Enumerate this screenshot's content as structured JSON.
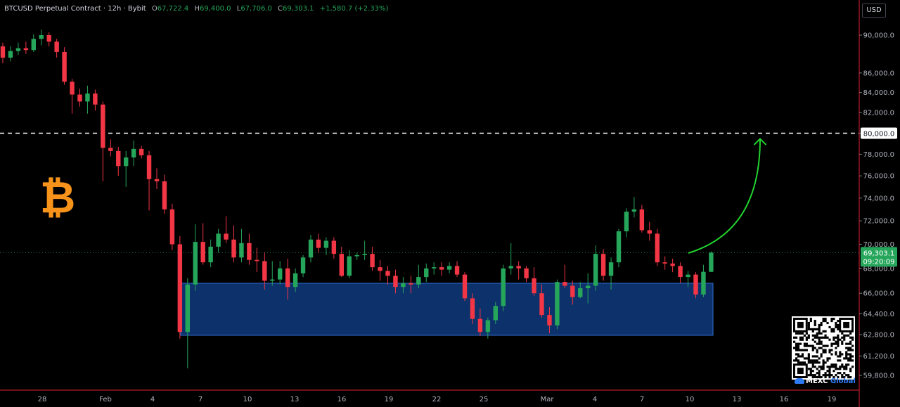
{
  "header": {
    "symbol": "BTCUSD Perpetual Contract",
    "interval": "12h",
    "exchange": "Bybit",
    "o_label": "O",
    "o_value": "67,722.4",
    "h_label": "H",
    "h_value": "69,400.0",
    "l_label": "L",
    "l_value": "67,706.0",
    "c_label": "C",
    "c_value": "69,303.1",
    "change": "+1,580.7 (+2.33%)"
  },
  "currency_button": "USD",
  "price_label": {
    "price": "69,303.1",
    "countdown": "09:20:09"
  },
  "level_label": "80,000.0",
  "branding": {
    "exchange_name": "MEXC",
    "exchange_suffix": "Global",
    "logo_icon": "bitcoin-icon",
    "qr_icon": "qr-code-icon"
  },
  "colors": {
    "up": "#26a65b",
    "down": "#f23645",
    "zone": "#0f3a7d",
    "zone_border": "#2f6fd6",
    "arrow": "#22d32e",
    "bitcoin": "#f7931a"
  },
  "chart_data": {
    "type": "candlestick",
    "interval": "12h",
    "y_scale": "log",
    "ylim": [
      59000,
      93000
    ],
    "y_ticks": [
      "90,000.0",
      "86,000.0",
      "84,000.0",
      "82,000.0",
      "80,000.0",
      "78,000.0",
      "76,000.0",
      "74,000.0",
      "72,000.0",
      "70,000.0",
      "68,000.0",
      "66,000.0",
      "64,400.0",
      "62,800.0",
      "61,200.0",
      "59,800.0"
    ],
    "x_ticks": [
      "28",
      "Feb",
      "4",
      "7",
      "10",
      "13",
      "16",
      "19",
      "22",
      "25",
      "Mar",
      "4",
      "7",
      "10",
      "13",
      "16",
      "19"
    ],
    "candles": [
      {
        "o": 88800,
        "h": 89200,
        "l": 87000,
        "c": 87600
      },
      {
        "o": 87600,
        "h": 88800,
        "l": 87200,
        "c": 88300
      },
      {
        "o": 88300,
        "h": 89200,
        "l": 87900,
        "c": 88600
      },
      {
        "o": 88600,
        "h": 89300,
        "l": 88000,
        "c": 88400
      },
      {
        "o": 88400,
        "h": 90100,
        "l": 88200,
        "c": 89600
      },
      {
        "o": 89600,
        "h": 90600,
        "l": 88900,
        "c": 90000
      },
      {
        "o": 90000,
        "h": 90300,
        "l": 88800,
        "c": 89300
      },
      {
        "o": 89300,
        "h": 89600,
        "l": 87600,
        "c": 88200
      },
      {
        "o": 88200,
        "h": 88700,
        "l": 84800,
        "c": 85100
      },
      {
        "o": 85100,
        "h": 85400,
        "l": 81900,
        "c": 83800
      },
      {
        "o": 83800,
        "h": 84400,
        "l": 82600,
        "c": 83100
      },
      {
        "o": 83100,
        "h": 84700,
        "l": 81900,
        "c": 83900
      },
      {
        "o": 83900,
        "h": 84300,
        "l": 82200,
        "c": 82800
      },
      {
        "o": 82800,
        "h": 83100,
        "l": 75500,
        "c": 78600
      },
      {
        "o": 78600,
        "h": 79400,
        "l": 77800,
        "c": 78300
      },
      {
        "o": 78300,
        "h": 78700,
        "l": 76000,
        "c": 76900
      },
      {
        "o": 76900,
        "h": 78300,
        "l": 75000,
        "c": 77700
      },
      {
        "o": 77700,
        "h": 79300,
        "l": 76900,
        "c": 78500
      },
      {
        "o": 78500,
        "h": 78800,
        "l": 77600,
        "c": 77900
      },
      {
        "o": 77900,
        "h": 78300,
        "l": 72900,
        "c": 75700
      },
      {
        "o": 75700,
        "h": 76700,
        "l": 74800,
        "c": 75500
      },
      {
        "o": 75500,
        "h": 76100,
        "l": 72600,
        "c": 73000
      },
      {
        "o": 73000,
        "h": 73500,
        "l": 69500,
        "c": 70000
      },
      {
        "o": 70000,
        "h": 70700,
        "l": 62500,
        "c": 63000
      },
      {
        "o": 63000,
        "h": 67200,
        "l": 60300,
        "c": 66700
      },
      {
        "o": 66700,
        "h": 71700,
        "l": 66200,
        "c": 70200
      },
      {
        "o": 70200,
        "h": 71800,
        "l": 68300,
        "c": 68500
      },
      {
        "o": 68500,
        "h": 70400,
        "l": 68100,
        "c": 69800
      },
      {
        "o": 69800,
        "h": 71300,
        "l": 69300,
        "c": 70900
      },
      {
        "o": 70900,
        "h": 72400,
        "l": 70100,
        "c": 70400
      },
      {
        "o": 70400,
        "h": 71600,
        "l": 68500,
        "c": 68900
      },
      {
        "o": 68900,
        "h": 71300,
        "l": 68500,
        "c": 70100
      },
      {
        "o": 70100,
        "h": 70900,
        "l": 68300,
        "c": 68700
      },
      {
        "o": 68700,
        "h": 69700,
        "l": 67700,
        "c": 68600
      },
      {
        "o": 68600,
        "h": 69300,
        "l": 66300,
        "c": 67000
      },
      {
        "o": 67000,
        "h": 68600,
        "l": 66600,
        "c": 67100
      },
      {
        "o": 67100,
        "h": 68600,
        "l": 66700,
        "c": 68000
      },
      {
        "o": 68000,
        "h": 68800,
        "l": 65500,
        "c": 66500
      },
      {
        "o": 66500,
        "h": 68000,
        "l": 66100,
        "c": 67600
      },
      {
        "o": 67600,
        "h": 69100,
        "l": 67300,
        "c": 68900
      },
      {
        "o": 68900,
        "h": 70800,
        "l": 68500,
        "c": 70400
      },
      {
        "o": 70400,
        "h": 70900,
        "l": 69300,
        "c": 69700
      },
      {
        "o": 69700,
        "h": 70600,
        "l": 69100,
        "c": 70300
      },
      {
        "o": 70300,
        "h": 70600,
        "l": 68800,
        "c": 69200
      },
      {
        "o": 69200,
        "h": 69800,
        "l": 67300,
        "c": 67400
      },
      {
        "o": 67400,
        "h": 69500,
        "l": 67200,
        "c": 69000
      },
      {
        "o": 69000,
        "h": 69300,
        "l": 68700,
        "c": 69100
      },
      {
        "o": 69100,
        "h": 70300,
        "l": 68700,
        "c": 69200
      },
      {
        "o": 69200,
        "h": 69800,
        "l": 67800,
        "c": 68100
      },
      {
        "o": 68100,
        "h": 68700,
        "l": 67000,
        "c": 67800
      },
      {
        "o": 67800,
        "h": 68200,
        "l": 66700,
        "c": 67400
      },
      {
        "o": 67400,
        "h": 67900,
        "l": 66000,
        "c": 66500
      },
      {
        "o": 66500,
        "h": 67300,
        "l": 66000,
        "c": 66800
      },
      {
        "o": 66800,
        "h": 67400,
        "l": 66000,
        "c": 66700
      },
      {
        "o": 66700,
        "h": 68300,
        "l": 66400,
        "c": 67300
      },
      {
        "o": 67300,
        "h": 68400,
        "l": 66900,
        "c": 68000
      },
      {
        "o": 68000,
        "h": 68500,
        "l": 67500,
        "c": 68100
      },
      {
        "o": 68100,
        "h": 68500,
        "l": 67400,
        "c": 67900
      },
      {
        "o": 67900,
        "h": 68500,
        "l": 67600,
        "c": 68200
      },
      {
        "o": 68200,
        "h": 68600,
        "l": 67300,
        "c": 67500
      },
      {
        "o": 67500,
        "h": 67700,
        "l": 65400,
        "c": 65600
      },
      {
        "o": 65600,
        "h": 66000,
        "l": 63600,
        "c": 64000
      },
      {
        "o": 64000,
        "h": 64800,
        "l": 62700,
        "c": 63000
      },
      {
        "o": 63000,
        "h": 64100,
        "l": 62500,
        "c": 63900
      },
      {
        "o": 63900,
        "h": 65300,
        "l": 63600,
        "c": 65000
      },
      {
        "o": 65000,
        "h": 68300,
        "l": 64600,
        "c": 68000
      },
      {
        "o": 68000,
        "h": 70100,
        "l": 67500,
        "c": 68200
      },
      {
        "o": 68200,
        "h": 68600,
        "l": 67100,
        "c": 68000
      },
      {
        "o": 68000,
        "h": 68200,
        "l": 66900,
        "c": 67200
      },
      {
        "o": 67200,
        "h": 68100,
        "l": 65800,
        "c": 66000
      },
      {
        "o": 66000,
        "h": 66700,
        "l": 64100,
        "c": 64300
      },
      {
        "o": 64300,
        "h": 64900,
        "l": 62900,
        "c": 63500
      },
      {
        "o": 63500,
        "h": 67100,
        "l": 63200,
        "c": 66900
      },
      {
        "o": 66900,
        "h": 68300,
        "l": 66400,
        "c": 66600
      },
      {
        "o": 66600,
        "h": 67000,
        "l": 65100,
        "c": 65700
      },
      {
        "o": 65700,
        "h": 66900,
        "l": 65600,
        "c": 66400
      },
      {
        "o": 66400,
        "h": 67600,
        "l": 65200,
        "c": 66600
      },
      {
        "o": 66600,
        "h": 69900,
        "l": 66200,
        "c": 69200
      },
      {
        "o": 69200,
        "h": 69600,
        "l": 67000,
        "c": 67400
      },
      {
        "o": 67400,
        "h": 68900,
        "l": 66300,
        "c": 68500
      },
      {
        "o": 68500,
        "h": 71300,
        "l": 68100,
        "c": 71100
      },
      {
        "o": 71100,
        "h": 73100,
        "l": 70600,
        "c": 72800
      },
      {
        "o": 72800,
        "h": 74100,
        "l": 72300,
        "c": 73000
      },
      {
        "o": 73000,
        "h": 73400,
        "l": 71000,
        "c": 71200
      },
      {
        "o": 71200,
        "h": 71900,
        "l": 70300,
        "c": 70900
      },
      {
        "o": 70900,
        "h": 71300,
        "l": 68200,
        "c": 68500
      },
      {
        "o": 68500,
        "h": 69000,
        "l": 67900,
        "c": 68400
      },
      {
        "o": 68400,
        "h": 68800,
        "l": 67700,
        "c": 68200
      },
      {
        "o": 68200,
        "h": 68500,
        "l": 66800,
        "c": 67300
      },
      {
        "o": 67300,
        "h": 67800,
        "l": 66500,
        "c": 67500
      },
      {
        "o": 67500,
        "h": 67700,
        "l": 65600,
        "c": 65900
      },
      {
        "o": 65900,
        "h": 68300,
        "l": 65700,
        "c": 67722.4
      },
      {
        "o": 67722.4,
        "h": 69400,
        "l": 67706,
        "c": 69303.1
      }
    ],
    "zone": {
      "from_candle": 24,
      "to_candle": 100,
      "low": 62750,
      "high": 66800
    },
    "horizontal_line": 80000,
    "last_price_line": 69303.1,
    "forecast_arrow_target": 80000
  }
}
